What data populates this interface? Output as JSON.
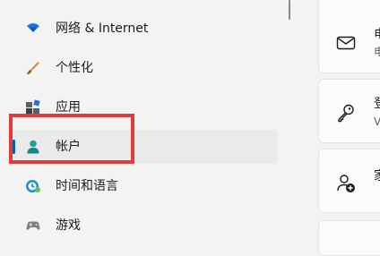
{
  "nav": {
    "items": [
      {
        "label": "网络 & Internet",
        "icon": "wifi-icon",
        "selected": false
      },
      {
        "label": "个性化",
        "icon": "paintbrush-icon",
        "selected": false
      },
      {
        "label": "应用",
        "icon": "apps-icon",
        "selected": false
      },
      {
        "label": "帐户",
        "icon": "account-icon",
        "selected": true
      },
      {
        "label": "时间和语言",
        "icon": "time-language-icon",
        "selected": false
      },
      {
        "label": "游戏",
        "icon": "gamepad-icon",
        "selected": false
      }
    ]
  },
  "cards": [
    {
      "icon": "mail-icon",
      "title": "电",
      "subtitle": "电"
    },
    {
      "icon": "key-icon",
      "title": "登",
      "subtitle": "V"
    },
    {
      "icon": "add-person-icon",
      "title": "家",
      "subtitle": ""
    }
  ],
  "colors": {
    "accent": "#005fb8",
    "highlight_border": "#e23b3b",
    "background": "#f3f3f3",
    "card_background": "#fbfbfb"
  }
}
